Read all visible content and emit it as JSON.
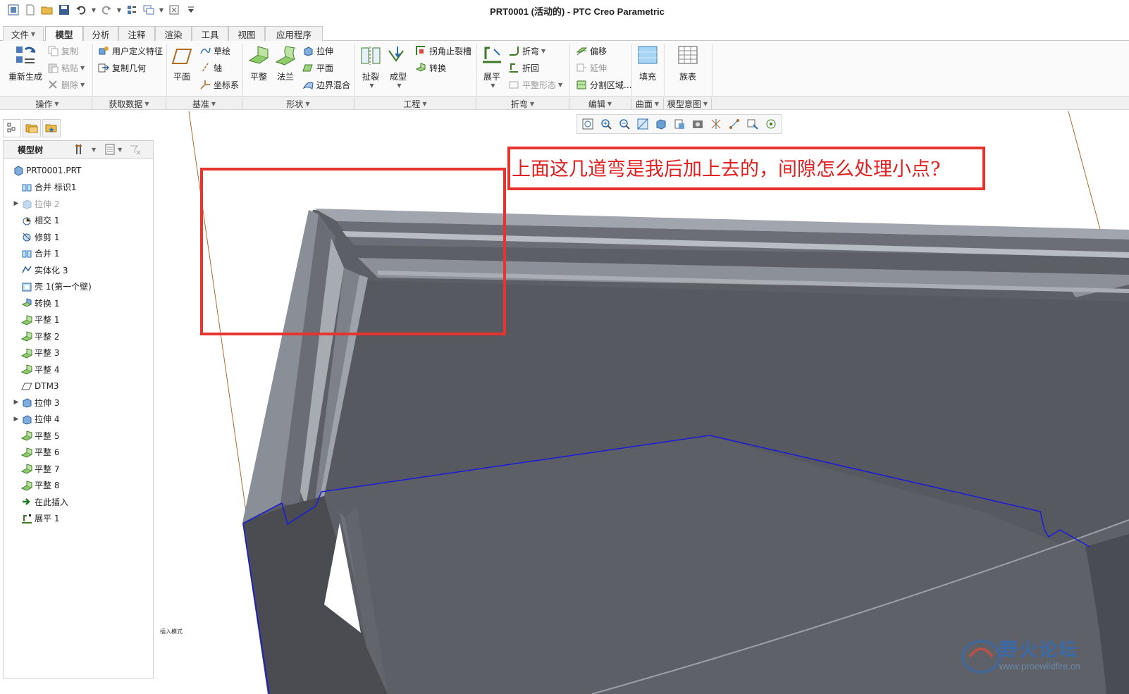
{
  "window": {
    "title": "PRT0001 (活动的) - PTC Creo Parametric"
  },
  "quick_access": [
    "app-icon",
    "new-icon",
    "open-icon",
    "save-icon",
    "undo-icon",
    "redo-icon",
    "regenerate-icon",
    "windows-icon",
    "close-icon",
    "customize-icon"
  ],
  "tabs": [
    {
      "label": "文件"
    },
    {
      "label": "模型"
    },
    {
      "label": "分析"
    },
    {
      "label": "注释"
    },
    {
      "label": "渲染"
    },
    {
      "label": "工具"
    },
    {
      "label": "视图"
    },
    {
      "label": "应用程序"
    }
  ],
  "active_tab": "模型",
  "ribbon": {
    "groups": {
      "operations": "操作",
      "get_data": "获取数据",
      "datum": "基准",
      "shapes": "形状",
      "engineering": "工程",
      "bends": "折弯",
      "editing": "编辑",
      "surfaces": "曲面",
      "model_intent": "模型意图"
    },
    "regenerate": "重新生成",
    "copy": "复制",
    "paste": "粘贴",
    "delete": "删除",
    "user_defined_feature": "用户定义特征",
    "copy_geometry": "复制几何",
    "plane": "平面",
    "sketch": "草绘",
    "axis": "轴",
    "coord_sys": "坐标系",
    "flat": "平整",
    "flange": "法兰",
    "extrude": "拉伸",
    "planar": "平面",
    "boundary_blend": "边界混合",
    "rip": "扯裂",
    "form": "成型",
    "corner_relief": "拐角止裂槽",
    "convert": "转换",
    "unbend": "展平",
    "bend": "折弯",
    "bend_back": "折回",
    "flatten_form": "平整形态",
    "offset": "偏移",
    "extend": "延伸",
    "split_area": "分割区域...",
    "fill": "填充",
    "family_table": "族表"
  },
  "model_tree": {
    "title": "模型树",
    "items": [
      {
        "label": "PRT0001.PRT",
        "icon": "part-icon",
        "expandable": false,
        "dim": false
      },
      {
        "label": "合并 标识1",
        "icon": "merge-icon",
        "expandable": false,
        "dim": false
      },
      {
        "label": "拉伸 2",
        "icon": "extrude-icon",
        "expandable": true,
        "dim": true
      },
      {
        "label": "相交 1",
        "icon": "intersect-icon",
        "expandable": false,
        "dim": false
      },
      {
        "label": "修剪 1",
        "icon": "trim-icon",
        "expandable": false,
        "dim": false
      },
      {
        "label": "合并 1",
        "icon": "merge-icon",
        "expandable": false,
        "dim": false
      },
      {
        "label": "实体化 3",
        "icon": "solidify-icon",
        "expandable": false,
        "dim": false
      },
      {
        "label": "壳 1(第一个壁)",
        "icon": "shell-icon",
        "expandable": false,
        "dim": false
      },
      {
        "label": "转换 1",
        "icon": "convert-icon",
        "expandable": false,
        "dim": false
      },
      {
        "label": "平整 1",
        "icon": "flat-wall-icon",
        "expandable": false,
        "dim": false
      },
      {
        "label": "平整 2",
        "icon": "flat-wall-icon",
        "expandable": false,
        "dim": false
      },
      {
        "label": "平整 3",
        "icon": "flat-wall-icon",
        "expandable": false,
        "dim": false
      },
      {
        "label": "平整 4",
        "icon": "flat-wall-icon",
        "expandable": false,
        "dim": false
      },
      {
        "label": "DTM3",
        "icon": "datum-plane-icon",
        "expandable": false,
        "dim": false
      },
      {
        "label": "拉伸 3",
        "icon": "extrude-icon",
        "expandable": true,
        "dim": false
      },
      {
        "label": "拉伸 4",
        "icon": "extrude-icon",
        "expandable": true,
        "dim": false
      },
      {
        "label": "平整 5",
        "icon": "flat-wall-icon",
        "expandable": false,
        "dim": false
      },
      {
        "label": "平整 6",
        "icon": "flat-wall-icon",
        "expandable": false,
        "dim": false
      },
      {
        "label": "平整 7",
        "icon": "flat-wall-icon",
        "expandable": false,
        "dim": false
      },
      {
        "label": "平整 8",
        "icon": "flat-wall-icon",
        "expandable": false,
        "dim": false
      },
      {
        "label": "在此插入",
        "icon": "insert-here-icon",
        "expandable": false,
        "dim": false
      },
      {
        "label": "展平 1",
        "icon": "unbend-icon",
        "expandable": false,
        "dim": false
      }
    ]
  },
  "annotation": {
    "text": "上面这几道弯是我后加上去的，间隙怎么处理小点?"
  },
  "status": {
    "mode_text": "插入模式"
  },
  "watermark": {
    "title": "野火论坛",
    "url": "www.proewildfire.cn"
  },
  "colors": {
    "annotation_red": "#e8342f",
    "model_face": "#5c5e66",
    "model_edge_highlight": "#9ea3ac",
    "selection_blue": "#1a1ad8",
    "datum_line": "#b06a30"
  }
}
